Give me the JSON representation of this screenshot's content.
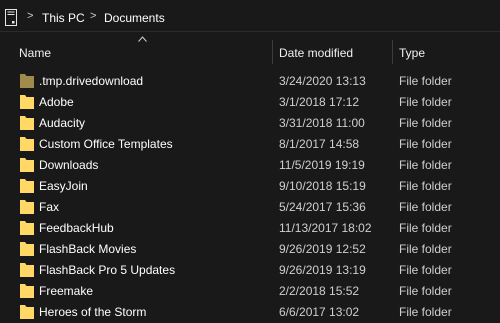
{
  "address_bar": {
    "segments": [
      "This PC",
      "Documents"
    ],
    "separator": ">"
  },
  "columns": {
    "name": "Name",
    "date_modified": "Date modified",
    "type": "Type"
  },
  "sort": {
    "column": "name",
    "direction": "ascending"
  },
  "colors": {
    "background": "#191919",
    "folder": "#ffd865",
    "folder_hidden": "#a08a4c",
    "text": "#ffffff",
    "muted_text": "#cfcfcf"
  },
  "files": [
    {
      "name": ".tmp.drivedownload",
      "date": "3/24/2020 13:13",
      "type": "File folder",
      "hidden": true
    },
    {
      "name": "Adobe",
      "date": "3/1/2018 17:12",
      "type": "File folder",
      "hidden": false
    },
    {
      "name": "Audacity",
      "date": "3/31/2018 11:00",
      "type": "File folder",
      "hidden": false
    },
    {
      "name": "Custom Office Templates",
      "date": "8/1/2017 14:58",
      "type": "File folder",
      "hidden": false
    },
    {
      "name": "Downloads",
      "date": "11/5/2019 19:19",
      "type": "File folder",
      "hidden": false
    },
    {
      "name": "EasyJoin",
      "date": "9/10/2018 15:19",
      "type": "File folder",
      "hidden": false
    },
    {
      "name": "Fax",
      "date": "5/24/2017 15:36",
      "type": "File folder",
      "hidden": false
    },
    {
      "name": "FeedbackHub",
      "date": "11/13/2017 18:02",
      "type": "File folder",
      "hidden": false
    },
    {
      "name": "FlashBack Movies",
      "date": "9/26/2019 12:52",
      "type": "File folder",
      "hidden": false
    },
    {
      "name": "FlashBack Pro 5 Updates",
      "date": "9/26/2019 13:19",
      "type": "File folder",
      "hidden": false
    },
    {
      "name": "Freemake",
      "date": "2/2/2018 15:52",
      "type": "File folder",
      "hidden": false
    },
    {
      "name": "Heroes of the Storm",
      "date": "6/6/2017 13:02",
      "type": "File folder",
      "hidden": false
    }
  ]
}
